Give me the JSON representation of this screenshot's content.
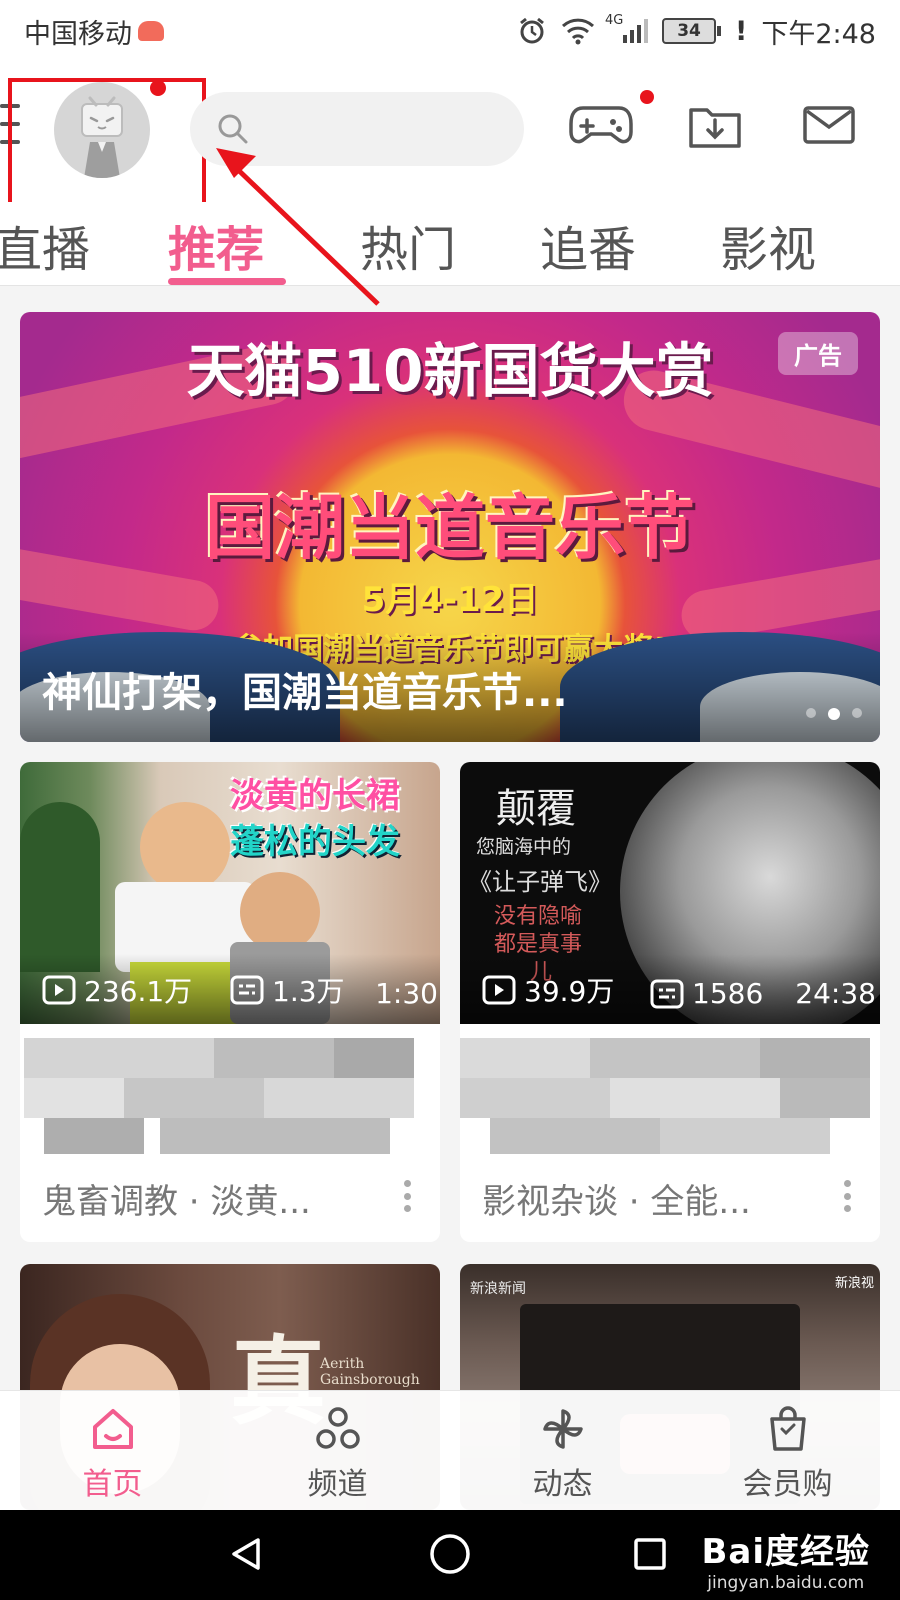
{
  "status_bar": {
    "carrier": "中国移动",
    "network": "4G",
    "battery": "34",
    "time": "下午2:48"
  },
  "header": {
    "search_placeholder": ""
  },
  "tabs": [
    {
      "label": "直播"
    },
    {
      "label": "推荐"
    },
    {
      "label": "热门"
    },
    {
      "label": "追番"
    },
    {
      "label": "影视"
    }
  ],
  "banner": {
    "headline": "天猫510新国货大赏",
    "ad_label": "广告",
    "festival": "国潮当道音乐节",
    "dates": "5月4-12日",
    "promo": "参加国潮当道音乐节即可赢大奖!",
    "title": "神仙打架，国潮当道音乐节..."
  },
  "videos": [
    {
      "thumb_text_1": "淡黄的长裙",
      "thumb_text_2": "蓬松的头发",
      "plays": "236.1万",
      "danmaku": "1.3万",
      "duration": "1:30",
      "meta": "鬼畜调教 · 淡黄..."
    },
    {
      "thumb_text_1": "颠覆",
      "thumb_text_2": "您脑海中的",
      "thumb_text_3": "《让子弹飞》",
      "thumb_text_4": "没有隐喻",
      "thumb_text_5": "都是真事",
      "thumb_text_6": "儿",
      "plays": "39.9万",
      "danmaku": "1586",
      "duration": "24:38",
      "meta": "影视杂谈 · 全能..."
    },
    {
      "thumb_text_1": "真",
      "thumb_text_2": "Aerith",
      "thumb_text_3": "Gainsborough"
    },
    {
      "thumb_text_1": "新浪视",
      "thumb_text_2": "新浪新闻"
    }
  ],
  "bottom_nav": [
    {
      "label": "首页",
      "icon": "home-icon",
      "active": true
    },
    {
      "label": "频道",
      "icon": "channel-icon",
      "active": false
    },
    {
      "label": "动态",
      "icon": "pinwheel-icon",
      "active": false
    },
    {
      "label": "会员购",
      "icon": "shopping-bag-icon",
      "active": false
    }
  ],
  "watermark": {
    "main": "Bai度经验",
    "sub": "jingyan.baidu.com"
  },
  "colors": {
    "accent": "#f25d8e",
    "highlight": "#e8141c"
  }
}
